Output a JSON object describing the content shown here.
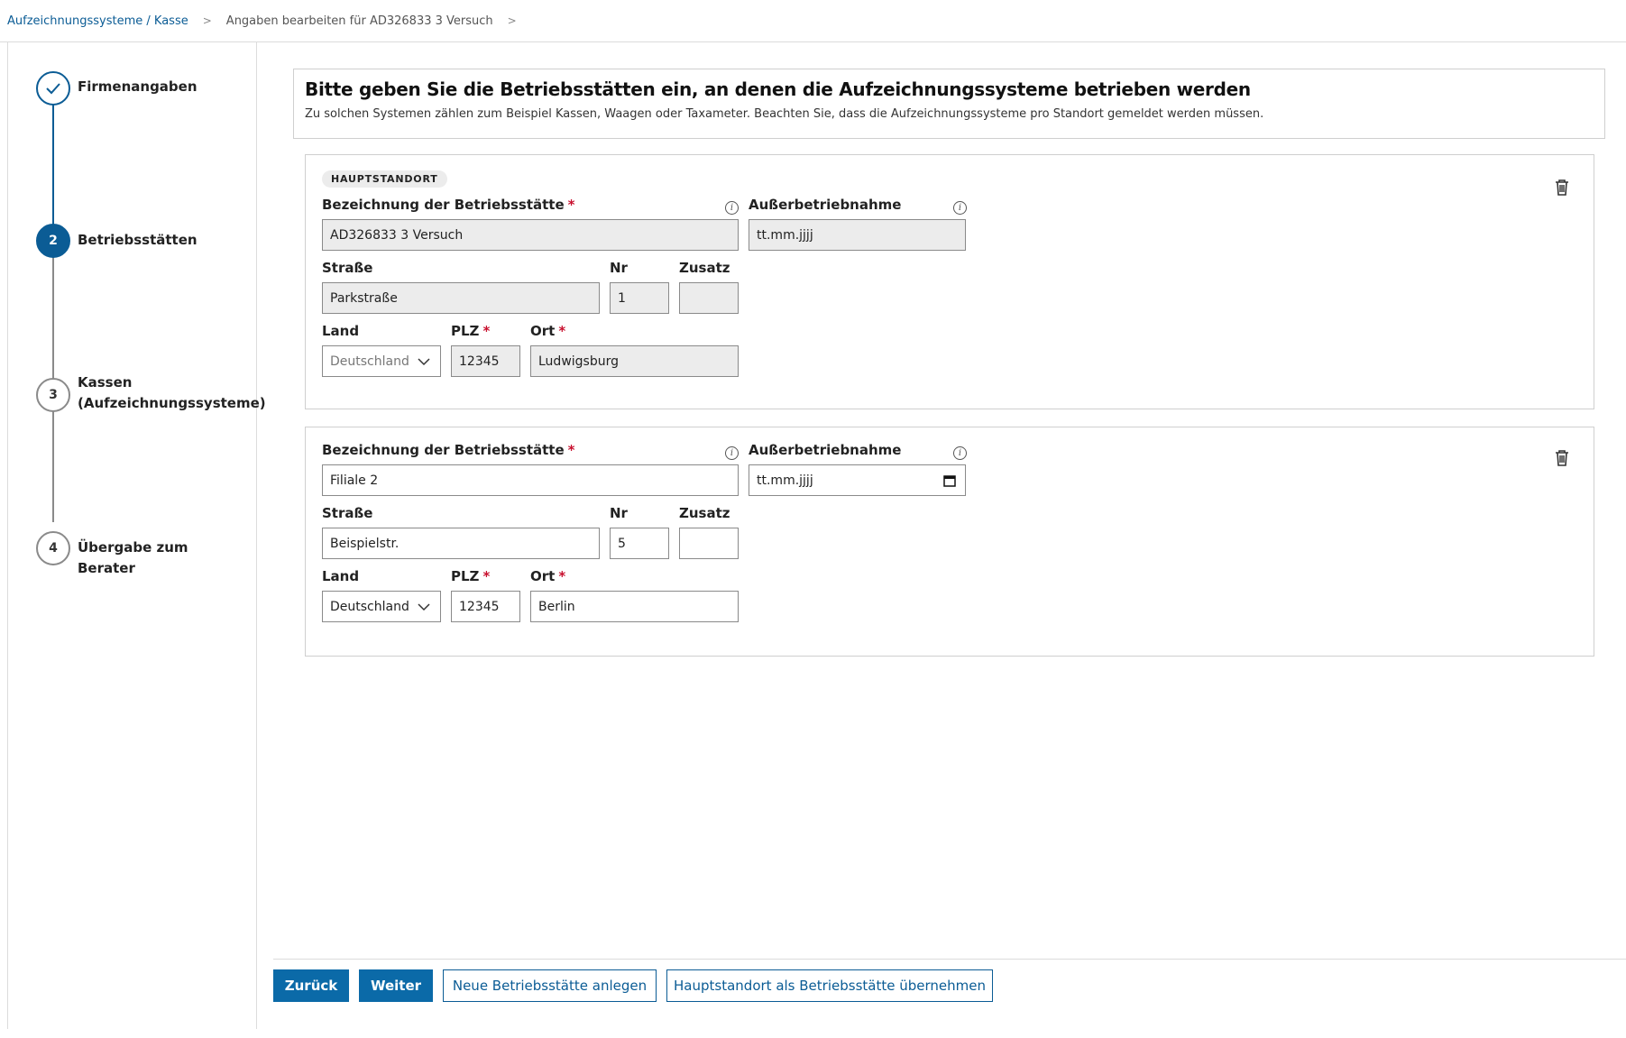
{
  "breadcrumb": {
    "link": "Aufzeichnungssysteme / Kasse",
    "current": "Angaben bearbeiten für AD326833 3 Versuch"
  },
  "stepper": [
    {
      "number": "✓",
      "label": "Firmenangaben",
      "state": "done"
    },
    {
      "number": "2",
      "label": "Betriebsstätten",
      "state": "active"
    },
    {
      "number": "3",
      "label": "Kassen (Aufzeichnungssysteme)",
      "state": "todo"
    },
    {
      "number": "4",
      "label": "Übergabe zum Berater",
      "state": "todo"
    }
  ],
  "intro": {
    "title": "Bitte geben Sie die Betriebsstätten ein, an denen die Aufzeichnungssysteme betrieben werden",
    "text": "Zu solchen Systemen zählen zum Beispiel Kassen, Waagen oder Taxameter. Beachten Sie, dass die Aufzeichnungssysteme pro Standort gemeldet werden müssen."
  },
  "labels": {
    "bezeichnung": "Bezeichnung der Betriebsstätte",
    "ausser": "Außerbetriebnahme",
    "strasse": "Straße",
    "nr": "Nr",
    "zusatz": "Zusatz",
    "land": "Land",
    "plz": "PLZ",
    "ort": "Ort",
    "required": "*"
  },
  "locations": [
    {
      "badge": "HAUPTSTANDORT",
      "bezeichnung": "AD326833 3 Versuch",
      "ausser": "tt.mm.jjjj",
      "strasse": "Parkstraße",
      "nr": "1",
      "zusatz": "",
      "land": "Deutschland",
      "plz": "12345",
      "ort": "Ludwigsburg"
    },
    {
      "bezeichnung": "Filiale 2",
      "ausser": "tt.mm.jjjj",
      "strasse": "Beispielstr.",
      "nr": "5",
      "zusatz": "",
      "land": "Deutschland",
      "plz": "12345",
      "ort": "Berlin"
    }
  ],
  "buttons": {
    "back": "Zurück",
    "next": "Weiter",
    "new": "Neue Betriebsstätte anlegen",
    "copy": "Hauptstandort als Betriebsstätte übernehmen"
  },
  "colors": {
    "primary": "#0b6aa8",
    "link": "#0b5c95",
    "required": "#c8102e",
    "readonly_bg": "#ececec"
  }
}
